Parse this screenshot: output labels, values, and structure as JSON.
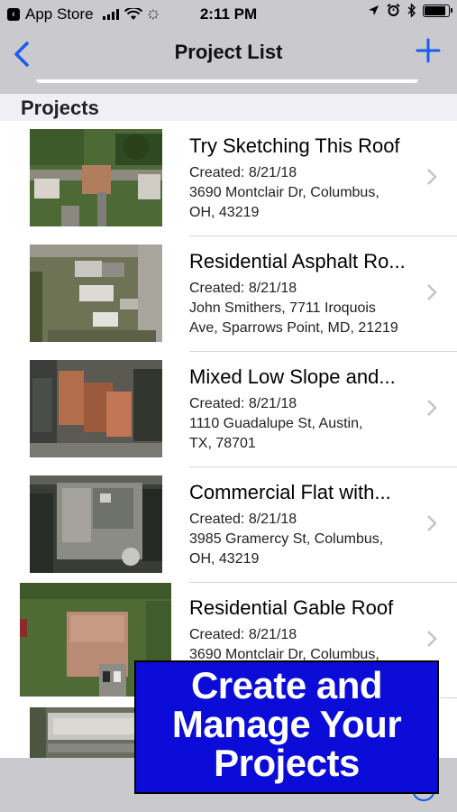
{
  "status_bar": {
    "back_app_label": "App Store",
    "time": "2:11 PM",
    "battery_level": 0.9
  },
  "nav": {
    "title": "Project List",
    "back_icon": "chevron-left-icon",
    "add_icon": "plus-icon"
  },
  "section": {
    "title": "Projects"
  },
  "projects": [
    {
      "title": "Try Sketching This Roof",
      "created": "Created: 8/21/18",
      "address_line1": "3690 Montclair Dr, Columbus,",
      "address_line2": "OH, 43219"
    },
    {
      "title": "Residential Asphalt Ro...",
      "created": "Created: 8/21/18",
      "address_line1": "John Smithers, 7711 Iroquois",
      "address_line2": "Ave, Sparrows Point, MD, 21219"
    },
    {
      "title": "Mixed Low Slope and...",
      "created": "Created: 8/21/18",
      "address_line1": "1110 Guadalupe St, Austin,",
      "address_line2": "TX, 78701"
    },
    {
      "title": "Commercial Flat with...",
      "created": "Created: 8/21/18",
      "address_line1": "3985 Gramercy St, Columbus,",
      "address_line2": "OH, 43219"
    },
    {
      "title": "Residential Gable Roof",
      "created": "Created: 8/21/18",
      "address_line1": "3690 Montclair Dr, Columbus,",
      "address_line2": ""
    }
  ],
  "banner": {
    "line1": "Create and",
    "line2": "Manage Your",
    "line3": "Projects"
  },
  "colors": {
    "accent": "#1a5cf0",
    "banner_bg": "#0b0cd8",
    "bar_bg": "#c9c9ce"
  }
}
